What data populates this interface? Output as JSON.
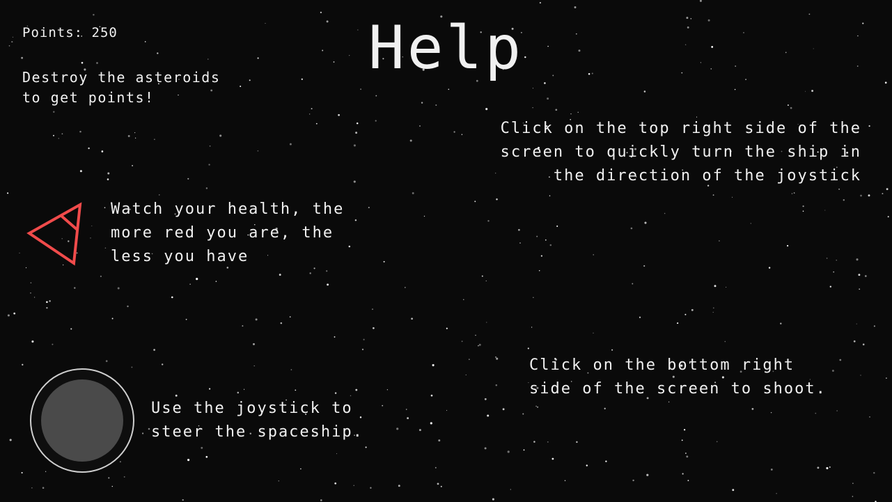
{
  "hud": {
    "points": "Points: 250",
    "objective": "Destroy the asteroids\nto get points!"
  },
  "title": "Help",
  "hints": {
    "turn": "Click on the top right side of the\nscreen to quickly turn the ship in\nthe direction of the joystick",
    "health": "Watch your health, the\nmore red you are, the\nless you have",
    "shoot": "Click on the bottom right\nside of the screen to shoot.",
    "joystick": "Use the joystick to\nsteer the spaceship."
  },
  "icons": {
    "ship": "ship-triangle-icon",
    "joystick": "joystick-control"
  },
  "colors": {
    "background": "#0a0a0a",
    "text": "#f0f0f0",
    "ship_damaged": "#f04b4b",
    "joystick_ring": "#cfcfcf",
    "joystick_knob": "#4a4a4a",
    "star": "#ffffff"
  }
}
